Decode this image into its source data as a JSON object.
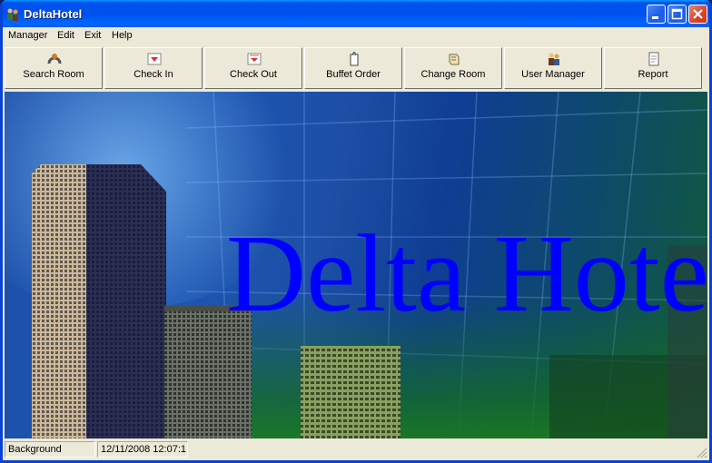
{
  "window": {
    "title": "DeltaHotel"
  },
  "menu": [
    "Manager",
    "Edit",
    "Exit",
    "Help"
  ],
  "toolbar": [
    {
      "label": "Search Room",
      "icon": "search-room-icon"
    },
    {
      "label": "Check In",
      "icon": "check-in-icon"
    },
    {
      "label": "Check Out",
      "icon": "check-out-icon"
    },
    {
      "label": "Buffet Order",
      "icon": "buffet-order-icon"
    },
    {
      "label": "Change Room",
      "icon": "change-room-icon"
    },
    {
      "label": "User Manager",
      "icon": "user-manager-icon"
    },
    {
      "label": "Report",
      "icon": "report-icon"
    }
  ],
  "background": {
    "brand_text": "Delta Hotel"
  },
  "status": {
    "pane1": "Background",
    "pane2": "12/11/2008 12:07:1"
  },
  "colors": {
    "titlebar": "#0054e3",
    "brand_text": "#0000ff",
    "chrome": "#ece9d8"
  }
}
